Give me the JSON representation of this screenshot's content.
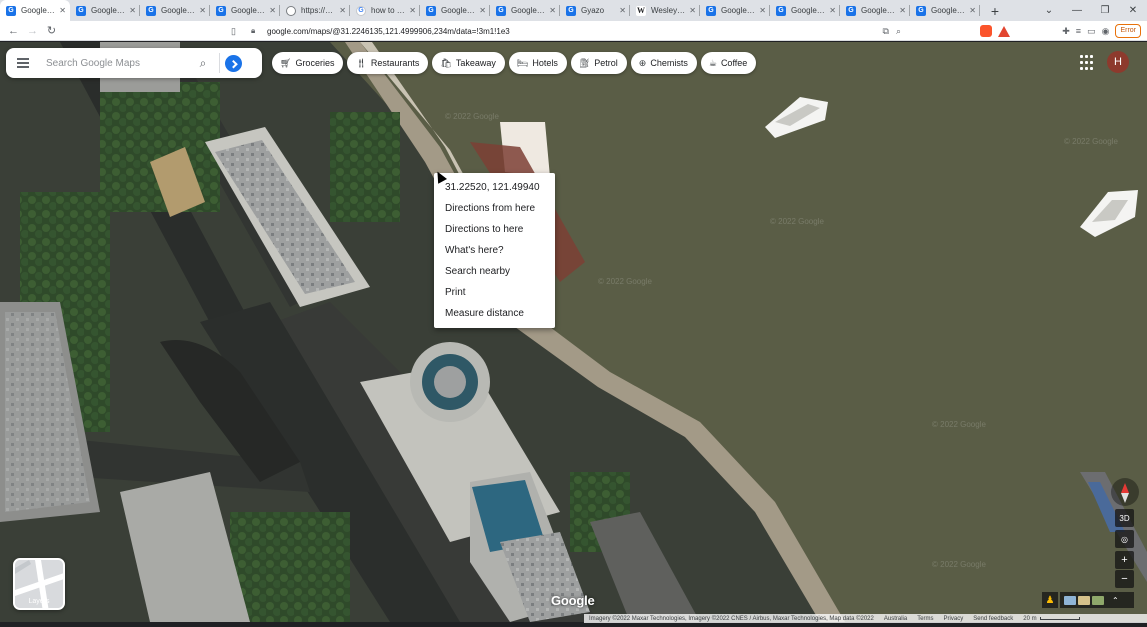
{
  "browser": {
    "tabs": [
      {
        "title": "Google Ma",
        "icon": "maps",
        "active": true
      },
      {
        "title": "Google Maps",
        "icon": "maps"
      },
      {
        "title": "Google Maps",
        "icon": "maps"
      },
      {
        "title": "Google Maps",
        "icon": "maps"
      },
      {
        "title": "https://gyazo",
        "icon": "globe"
      },
      {
        "title": "how to take a",
        "icon": "google"
      },
      {
        "title": "Google Maps",
        "icon": "maps"
      },
      {
        "title": "Google Maps",
        "icon": "maps"
      },
      {
        "title": "Gyazo",
        "icon": "maps"
      },
      {
        "title": "Wesley (footb",
        "icon": "wiki"
      },
      {
        "title": "Google Maps",
        "icon": "maps"
      },
      {
        "title": "Google Maps",
        "icon": "maps"
      },
      {
        "title": "Google Maps",
        "icon": "maps"
      },
      {
        "title": "Google Maps",
        "icon": "maps"
      }
    ],
    "url": "google.com/maps/@31.2246135,121.4999906,234m/data=!3m1!1e3",
    "error_label": "Error"
  },
  "search": {
    "placeholder": "Search Google Maps"
  },
  "chips": [
    {
      "label": "Groceries",
      "icon": "cart-icon"
    },
    {
      "label": "Restaurants",
      "icon": "fork-knife-icon"
    },
    {
      "label": "Takeaway",
      "icon": "bag-icon"
    },
    {
      "label": "Hotels",
      "icon": "bed-icon"
    },
    {
      "label": "Petrol",
      "icon": "fuel-icon"
    },
    {
      "label": "Chemists",
      "icon": "chemist-icon"
    },
    {
      "label": "Coffee",
      "icon": "coffee-icon"
    }
  ],
  "account": {
    "initial": "H"
  },
  "context_menu": {
    "coords": "31.22520, 121.49940",
    "items": [
      "Directions from here",
      "Directions to here",
      "What's here?",
      "Search nearby",
      "Print",
      "Measure distance"
    ]
  },
  "layers": {
    "label": "Layers"
  },
  "controls": {
    "tilt": "3D"
  },
  "attribution": {
    "imagery": "Imagery ©2022 Maxar Technologies, Imagery ©2022 CNES / Airbus, Maxar Technologies, Map data ©2022",
    "country": "Australia",
    "terms": "Terms",
    "privacy": "Privacy",
    "feedback": "Send feedback",
    "scale": "20 m",
    "logo": "Google"
  },
  "colors": {
    "river": "#5a5d46",
    "land": "#3f4a3a",
    "accent": "#1a73e8"
  }
}
